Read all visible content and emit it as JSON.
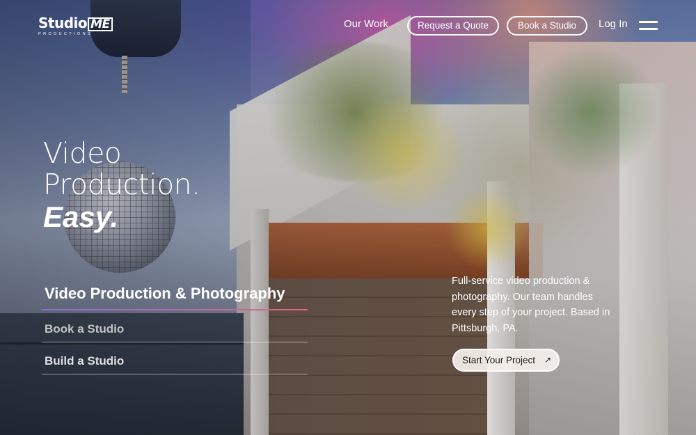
{
  "brand": {
    "name": "Studio",
    "name_mark": "ME",
    "tagline": "PRODUCTIONS"
  },
  "nav": {
    "our_work": "Our Work",
    "request_quote": "Request a Quote",
    "book_studio": "Book a Studio",
    "log_in": "Log In"
  },
  "hero": {
    "line1": "Video",
    "line2": "Production.",
    "line3": "Easy."
  },
  "services": [
    {
      "label": "Video Production & Photography",
      "active": true
    },
    {
      "label": "Book a Studio",
      "active": false
    },
    {
      "label": "Build a Studio",
      "active": false
    }
  ],
  "blurb": "Full-service video production & photography. Our team handles every step of your project. Based in Pittsburgh, PA.",
  "cta": {
    "label": "Start Your Project",
    "icon": "arrow-up-right-icon"
  },
  "colors": {
    "accent_start": "#8b6fd6",
    "accent_end": "#e0647e",
    "text": "#ffffff"
  }
}
